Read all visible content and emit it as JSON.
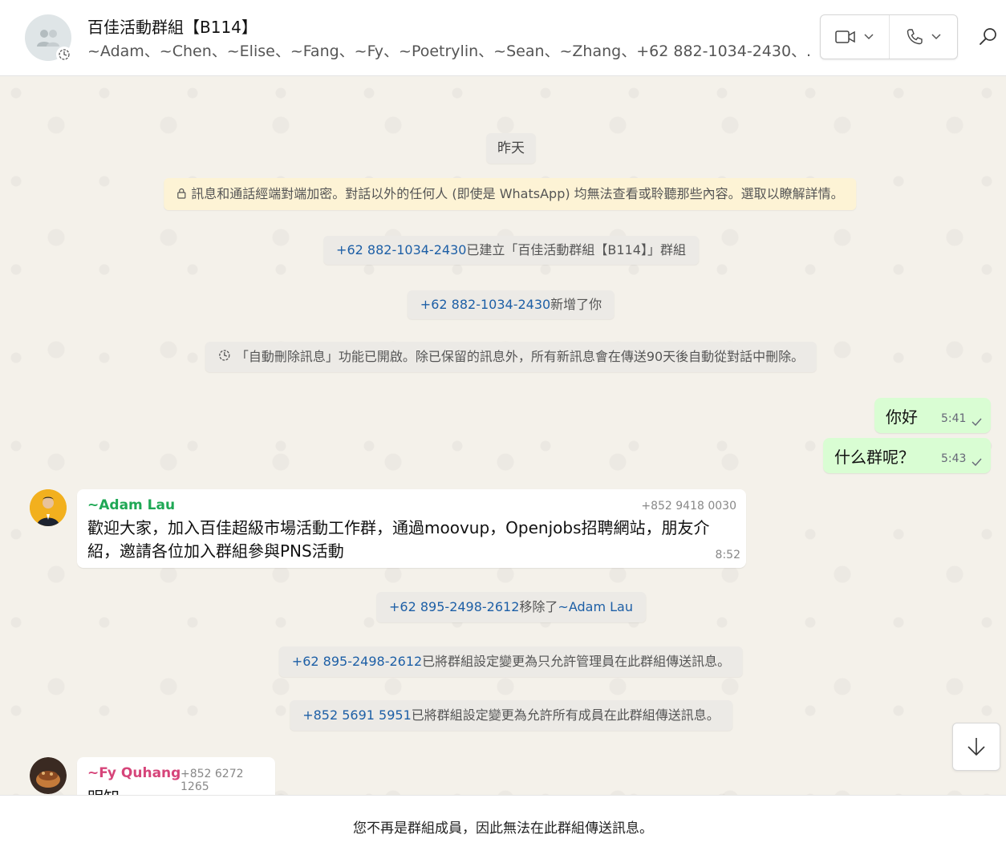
{
  "header": {
    "title": "百佳活動群組【B114】",
    "members": "~Adam、~Chen、~Elise、~Fang、~Fy、~Poetrylin、~Sean、~Zhang、+62 882-1034-2430、..."
  },
  "system": {
    "date_label": "昨天",
    "encryption_notice": "訊息和通話經端對端加密。對話以外的任何人 (即使是 WhatsApp) 均無法查看或聆聽那些內容。選取以瞭解詳情。",
    "created_by": "+62 882-1034-2430",
    "created_text": "已建立「百佳活動群組【B114】」群組",
    "added_by": "+62 882-1034-2430",
    "added_text": "新增了你",
    "auto_delete_text": "「自動刪除訊息」功能已開啟。除已保留的訊息外，所有新訊息會在傳送90天後自動從對話中刪除。",
    "removed_by": "+62 895-2498-2612",
    "removed_text": "移除了",
    "removed_target": "~Adam Lau",
    "admin_only_by": "+62 895-2498-2612",
    "admin_only_text": "已將群組設定變更為只允許管理員在此群組傳送訊息。",
    "all_members_by": "+852 5691 5951",
    "all_members_text": "已將群組設定變更為允許所有成員在此群組傳送訊息。"
  },
  "outgoing": [
    {
      "text": "你好",
      "time": "5:41"
    },
    {
      "text": "什么群呢？",
      "time": "5:43"
    }
  ],
  "incoming": [
    {
      "sender": "~Adam Lau",
      "phone": "+852 9418 0030",
      "line1": "歡迎大家，加入百佳超級市場活動工作群，通過moovup，Openjobs招聘網站，朋友介",
      "line2": "紹，邀請各位加入群組參與PNS活動",
      "time": "8:52",
      "color": "#1fa855"
    },
    {
      "sender": "~Fy Quhang",
      "phone": "+852 6272 1265",
      "partial_text": "明知",
      "color": "#d6457a"
    }
  ],
  "footer": {
    "notice": "您不再是群組成員，因此無法在此群組傳送訊息。"
  }
}
